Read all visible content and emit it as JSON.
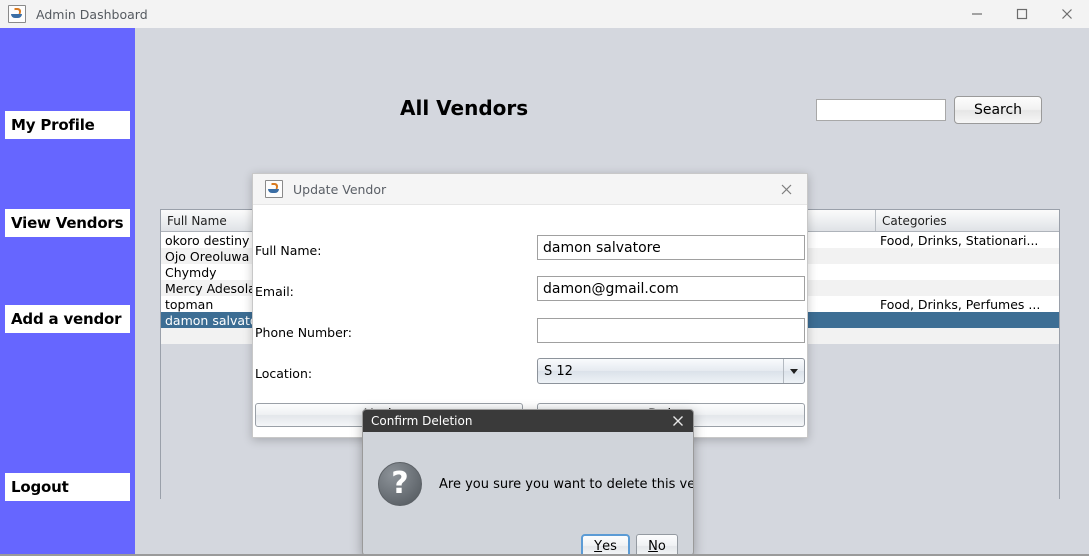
{
  "window": {
    "title": "Admin Dashboard",
    "icon": "java-coffee-cup-icon",
    "controls": {
      "minimize": "minimize-icon",
      "maximize": "maximize-icon",
      "close": "close-icon"
    }
  },
  "sidebar": {
    "background_color": "#6666ff",
    "items": [
      {
        "label": "My Profile"
      },
      {
        "label": "View Vendors"
      },
      {
        "label": "Add a vendor"
      },
      {
        "label": "Logout"
      }
    ]
  },
  "main": {
    "page_title": "All Vendors",
    "search": {
      "value": "",
      "placeholder": "",
      "button_label": "Search"
    },
    "table": {
      "columns": [
        "Full Name",
        "",
        "",
        "",
        "Categories"
      ],
      "rows": [
        {
          "full_name": "okoro destiny",
          "c1": "",
          "c2": "",
          "c3": "",
          "categories": "Food, Drinks, Stationari...",
          "selected": false
        },
        {
          "full_name": "Ojo Oreoluwa",
          "c1": "",
          "c2": "",
          "c3": "",
          "categories": "",
          "selected": false
        },
        {
          "full_name": "Chymdy",
          "c1": "",
          "c2": "",
          "c3": "",
          "categories": "",
          "selected": false
        },
        {
          "full_name": "Mercy Adesola",
          "c1": "",
          "c2": "",
          "c3": "",
          "categories": "",
          "selected": false
        },
        {
          "full_name": "topman",
          "c1": "",
          "c2": "",
          "c3": "",
          "categories": "Food, Drinks, Perfumes ...",
          "selected": false
        },
        {
          "full_name": "damon salvatore",
          "c1": "",
          "c2": "",
          "c3": "",
          "categories": "",
          "selected": true
        }
      ],
      "selection_color": "#3d6e94"
    }
  },
  "update_dialog": {
    "title": "Update Vendor",
    "icon": "java-coffee-cup-icon",
    "close_icon": "close-icon",
    "fields": {
      "full_name_label": "Full Name:",
      "full_name_value": "damon salvatore",
      "email_label": "Email:",
      "email_value": "damon@gmail.com",
      "phone_label": "Phone Number:",
      "phone_value": "",
      "location_label": "Location:",
      "location_value": "S 12"
    },
    "buttons": {
      "update": "Update",
      "delete": "Delete"
    }
  },
  "confirm_dialog": {
    "title": "Confirm Deletion",
    "close_icon": "close-icon",
    "icon": "question-mark-icon",
    "icon_glyph": "?",
    "message": "Are you sure you want to delete this vendor?",
    "buttons": {
      "yes_prefix": "",
      "yes_mnemonic": "Y",
      "yes_rest": "es",
      "no_mnemonic": "N",
      "no_rest": "o"
    },
    "focused_button": "Yes",
    "focus_color": "#5b9bd5"
  }
}
